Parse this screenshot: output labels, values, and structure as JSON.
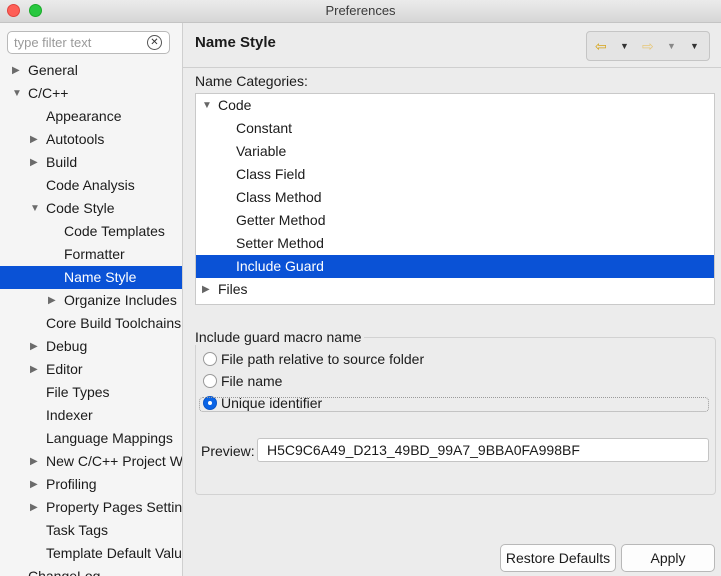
{
  "window": {
    "title": "Preferences"
  },
  "filter": {
    "placeholder": "type filter text"
  },
  "tree": [
    {
      "label": "General",
      "twisty": "closed",
      "indent": 0,
      "selected": false
    },
    {
      "label": "C/C++",
      "twisty": "open",
      "indent": 0,
      "selected": false
    },
    {
      "label": "Appearance",
      "twisty": "",
      "indent": 1,
      "selected": false
    },
    {
      "label": "Autotools",
      "twisty": "closed",
      "indent": 1,
      "selected": false
    },
    {
      "label": "Build",
      "twisty": "closed",
      "indent": 1,
      "selected": false
    },
    {
      "label": "Code Analysis",
      "twisty": "",
      "indent": 1,
      "selected": false
    },
    {
      "label": "Code Style",
      "twisty": "open",
      "indent": 1,
      "selected": false
    },
    {
      "label": "Code Templates",
      "twisty": "",
      "indent": 2,
      "selected": false
    },
    {
      "label": "Formatter",
      "twisty": "",
      "indent": 2,
      "selected": false
    },
    {
      "label": "Name Style",
      "twisty": "",
      "indent": 2,
      "selected": true
    },
    {
      "label": "Organize Includes",
      "twisty": "closed",
      "indent": 2,
      "selected": false
    },
    {
      "label": "Core Build Toolchains",
      "twisty": "",
      "indent": 1,
      "selected": false
    },
    {
      "label": "Debug",
      "twisty": "closed",
      "indent": 1,
      "selected": false
    },
    {
      "label": "Editor",
      "twisty": "closed",
      "indent": 1,
      "selected": false
    },
    {
      "label": "File Types",
      "twisty": "",
      "indent": 1,
      "selected": false
    },
    {
      "label": "Indexer",
      "twisty": "",
      "indent": 1,
      "selected": false
    },
    {
      "label": "Language Mappings",
      "twisty": "",
      "indent": 1,
      "selected": false
    },
    {
      "label": "New C/C++ Project Wizard",
      "twisty": "closed",
      "indent": 1,
      "selected": false
    },
    {
      "label": "Profiling",
      "twisty": "closed",
      "indent": 1,
      "selected": false
    },
    {
      "label": "Property Pages Settings",
      "twisty": "closed",
      "indent": 1,
      "selected": false
    },
    {
      "label": "Task Tags",
      "twisty": "",
      "indent": 1,
      "selected": false
    },
    {
      "label": "Template Default Values",
      "twisty": "",
      "indent": 1,
      "selected": false
    },
    {
      "label": "ChangeLog",
      "twisty": "",
      "indent": 0,
      "selected": false
    }
  ],
  "page": {
    "title": "Name Style"
  },
  "nav": {
    "back_icon": "back-arrow-icon",
    "forward_icon": "forward-arrow-icon",
    "menu_icon": "view-menu-icon"
  },
  "categories": {
    "label": "Name Categories:",
    "items": [
      {
        "label": "Code",
        "twisty": "open",
        "indent": 0,
        "selected": false
      },
      {
        "label": "Constant",
        "twisty": "",
        "indent": 1,
        "selected": false
      },
      {
        "label": "Variable",
        "twisty": "",
        "indent": 1,
        "selected": false
      },
      {
        "label": "Class Field",
        "twisty": "",
        "indent": 1,
        "selected": false
      },
      {
        "label": "Class Method",
        "twisty": "",
        "indent": 1,
        "selected": false
      },
      {
        "label": "Getter Method",
        "twisty": "",
        "indent": 1,
        "selected": false
      },
      {
        "label": "Setter Method",
        "twisty": "",
        "indent": 1,
        "selected": false
      },
      {
        "label": "Include Guard",
        "twisty": "",
        "indent": 1,
        "selected": true
      },
      {
        "label": "Files",
        "twisty": "closed",
        "indent": 0,
        "selected": false
      }
    ]
  },
  "guard": {
    "title": "Include guard macro name",
    "options": [
      {
        "label": "File path relative to source folder",
        "checked": false
      },
      {
        "label": "File name",
        "checked": false
      },
      {
        "label": "Unique identifier",
        "checked": true
      }
    ],
    "preview_label": "Preview:",
    "preview_value": "H5C9C6A49_D213_49BD_99A7_9BBA0FA998BF"
  },
  "buttons": {
    "restore": "Restore Defaults",
    "apply": "Apply"
  },
  "colors": {
    "selection": "#0a52d6",
    "close": "#fe5f57",
    "zoom": "#28c840"
  }
}
